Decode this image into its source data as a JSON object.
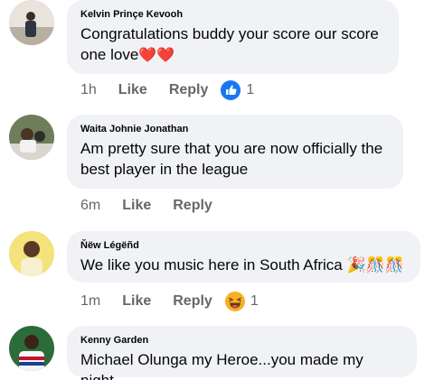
{
  "comments": [
    {
      "author": "Kelvin Prinçe Kevooh",
      "text": "Congratulations buddy your score our score one love",
      "emoji_suffix": "❤️❤️",
      "time": "1h",
      "like_label": "Like",
      "reply_label": "Reply",
      "reaction": "like-icon",
      "reaction_count": "1"
    },
    {
      "author": "Waita Johnie Jonathan",
      "text": "Am pretty sure that you are now officially the best player in the league",
      "time": "6m",
      "like_label": "Like",
      "reply_label": "Reply"
    },
    {
      "author": "Ňëw Légëñd",
      "text": "We like you music here in South Africa",
      "emoji_suffix": "🎉🎊🎊",
      "time": "1m",
      "like_label": "Like",
      "reply_label": "Reply",
      "reaction": "haha-icon",
      "reaction_count": "1"
    },
    {
      "author": "Kenny Garden",
      "text": "Michael Olunga my Heroe...you made my night."
    }
  ],
  "colors": {
    "bubble": "#f0f2f5",
    "meta_text": "#65676b",
    "like_blue": "#1877f2",
    "heart_red": "#e41e3f"
  }
}
